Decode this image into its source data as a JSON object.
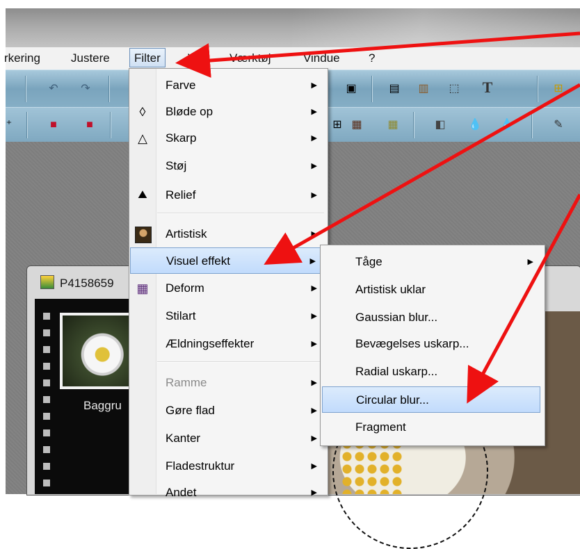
{
  "menubar": {
    "items": [
      "rkering",
      "Justere",
      "Filter",
      "Vis",
      "Værktøj",
      "Vindue",
      "?"
    ]
  },
  "document": {
    "title": "P4158659",
    "thumbnail_label": "Baggru"
  },
  "filter_menu": {
    "items": [
      {
        "label": "Farve",
        "icon": "none",
        "submenu": true
      },
      {
        "label": "Bløde op",
        "icon": "droplet-icon",
        "submenu": true
      },
      {
        "label": "Skarp",
        "icon": "triangle-icon",
        "submenu": true
      },
      {
        "label": "Støj",
        "icon": "none",
        "submenu": true
      },
      {
        "label": "Relief",
        "icon": "relief-icon",
        "submenu": true
      },
      {
        "label": "Artistisk",
        "icon": "mona-lisa-icon",
        "submenu": true
      },
      {
        "label": "Visuel effekt",
        "icon": "none",
        "submenu": true,
        "highlighted": true
      },
      {
        "label": "Deform",
        "icon": "deform-grid-icon",
        "submenu": true
      },
      {
        "label": "Stilart",
        "icon": "none",
        "submenu": true
      },
      {
        "label": "Ældningseffekter",
        "icon": "none",
        "submenu": true
      },
      {
        "label": "Ramme",
        "icon": "none",
        "submenu": true,
        "disabled": true
      },
      {
        "label": "Gøre flad",
        "icon": "none",
        "submenu": true
      },
      {
        "label": "Kanter",
        "icon": "none",
        "submenu": true
      },
      {
        "label": "Fladestruktur",
        "icon": "none",
        "submenu": true
      },
      {
        "label": "Andet",
        "icon": "none",
        "submenu": true
      }
    ]
  },
  "visual_effect_submenu": {
    "items": [
      {
        "label": "Tåge",
        "submenu": true
      },
      {
        "label": "Artistisk uklar"
      },
      {
        "label": "Gaussian blur..."
      },
      {
        "label": "Bevægelses uskarp..."
      },
      {
        "label": "Radial uskarp..."
      },
      {
        "label": "Circular blur...",
        "highlighted": true
      },
      {
        "label": "Fragment"
      }
    ]
  },
  "colors": {
    "highlight": "#c1dbfc",
    "annotation_arrow": "#ee1111",
    "toolbar": "#86afc6"
  }
}
